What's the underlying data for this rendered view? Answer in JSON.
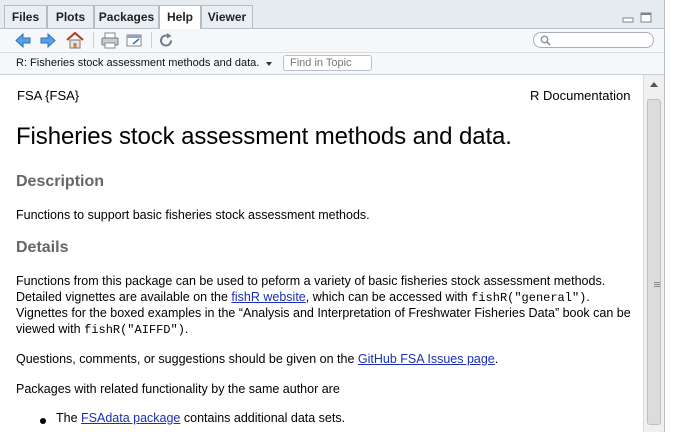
{
  "tabs": [
    {
      "label": "Files"
    },
    {
      "label": "Plots"
    },
    {
      "label": "Packages"
    },
    {
      "label": "Help"
    },
    {
      "label": "Viewer"
    }
  ],
  "toolbar": {
    "search_placeholder": ""
  },
  "topic_bar": {
    "current_topic": "R: Fisheries stock assessment methods and data.",
    "find_placeholder": "Find in Topic"
  },
  "doc": {
    "header_left": "FSA {FSA}",
    "header_right": "R Documentation",
    "title": "Fisheries stock assessment methods and data.",
    "description_heading": "Description",
    "description_text": "Functions to support basic fisheries stock assessment methods.",
    "details_heading": "Details",
    "details_p1_a": "Functions from this package can be used to peform a variety of basic fisheries stock assessment methods. Detailed vignettes are available on the ",
    "details_p1_link": "fishR website",
    "details_p1_b": ", which can be accessed with ",
    "details_p1_code1": "fishR(\"general\")",
    "details_p1_c": ". Vignettes for the boxed examples in the “Analysis and Interpretation of Freshwater Fisheries Data” book can be viewed with ",
    "details_p1_code2": "fishR(\"AIFFD\")",
    "details_p1_d": ".",
    "details_p2_a": "Questions, comments, or suggestions should be given on the ",
    "details_p2_link": "GitHub FSA Issues page",
    "details_p2_b": ".",
    "details_p3": "Packages with related functionality by the same author are",
    "bullet1_a": "The ",
    "bullet1_link": "FSAdata package",
    "bullet1_b": " contains additional data sets."
  }
}
